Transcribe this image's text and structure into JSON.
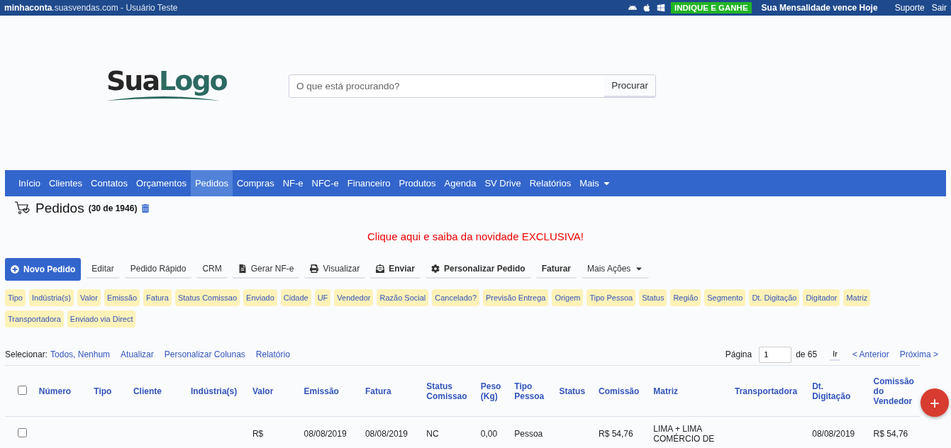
{
  "top_bar": {
    "site_bold": "minhaconta",
    "site_rest": ".suasvendas.com",
    "user": " - Usuário Teste",
    "promo": "INDIQUE E GANHE",
    "notice": "Sua Mensalidade vence Hoje",
    "links": [
      "Suporte",
      "Sair"
    ]
  },
  "logo": {
    "part1": "Sua",
    "part2": "Logo"
  },
  "search": {
    "placeholder": "O que está procurando?",
    "button": "Procurar"
  },
  "nav": [
    {
      "label": "Início",
      "selected": false
    },
    {
      "label": "Clientes",
      "selected": false
    },
    {
      "label": "Contatos",
      "selected": false
    },
    {
      "label": "Orçamentos",
      "selected": false
    },
    {
      "label": "Pedidos",
      "selected": true
    },
    {
      "label": "Compras",
      "selected": false
    },
    {
      "label": "NF-e",
      "selected": false
    },
    {
      "label": "NFC-e",
      "selected": false
    },
    {
      "label": "Financeiro",
      "selected": false
    },
    {
      "label": "Produtos",
      "selected": false
    },
    {
      "label": "Agenda",
      "selected": false
    },
    {
      "label": "SV Drive",
      "selected": false
    },
    {
      "label": "Relatórios",
      "selected": false
    },
    {
      "label": "Mais",
      "selected": false,
      "dropdown": true
    }
  ],
  "page": {
    "title": "Pedidos",
    "count": "(30 de 1946)",
    "promo_link": "Clique aqui e saiba da novidade EXCLUSIVA!"
  },
  "actions": [
    {
      "label": "Novo Pedido",
      "kind": "primary"
    },
    {
      "label": "Editar",
      "kind": "plain"
    },
    {
      "label": "Pedido Rápido",
      "kind": "plain"
    },
    {
      "label": "CRM",
      "kind": "plain"
    },
    {
      "label": "Gerar NF-e",
      "kind": "plain"
    },
    {
      "label": "Visualizar",
      "kind": "plain"
    },
    {
      "label": "Enviar",
      "kind": "bold"
    },
    {
      "label": "Personalizar Pedido",
      "kind": "bold"
    },
    {
      "label": "Faturar",
      "kind": "bold"
    },
    {
      "label": "Mais Ações",
      "kind": "dropdown"
    }
  ],
  "filters": [
    "Tipo",
    "Indústria(s)",
    "Valor",
    "Emissão",
    "Fatura",
    "Status Comissao",
    "Enviado",
    "Cidade",
    "UF",
    "Vendedor",
    "Razão Social",
    "Cancelado?",
    "Previsão Entrega",
    "Origem",
    "Tipo Pessoa",
    "Status",
    "Região",
    "Segmento",
    "Dt. Digitação",
    "Digitador",
    "Matriz",
    "Transportadora",
    "Enviado via Direct"
  ],
  "list_tools": {
    "select_label": "Selecionar:",
    "select_link": "Todos, Nenhum",
    "links": [
      "Atualizar",
      "Personalizar Colunas",
      "Relatório"
    ]
  },
  "pagination": {
    "label": "Página",
    "value": "1",
    "of": "de 65",
    "go": "Ir",
    "prev": "< Anterior",
    "next": "Próxima >"
  },
  "table": {
    "all_checked": false,
    "columns": [
      "Número",
      "Tipo",
      "Cliente",
      "Indústria(s)",
      "Valor",
      "Emissão",
      "Fatura",
      "Status Comissao",
      "Peso (Kg)",
      "Tipo Pessoa",
      "Status",
      "Comissão",
      "Matriz",
      "Transportadora",
      "Dt. Digitação",
      "Comissão do Vendedor"
    ],
    "rows": [
      {
        "checked": false,
        "cells": [
          "",
          "",
          "",
          "",
          "R$",
          "08/08/2019",
          "08/08/2019",
          "NC",
          "0,00",
          "Pessoa",
          "",
          "R$ 54,76",
          "LIMA + LIMA COMÉRCIO DE",
          "",
          "08/08/2019",
          "R$ 54,76"
        ]
      }
    ]
  },
  "fab": "+"
}
